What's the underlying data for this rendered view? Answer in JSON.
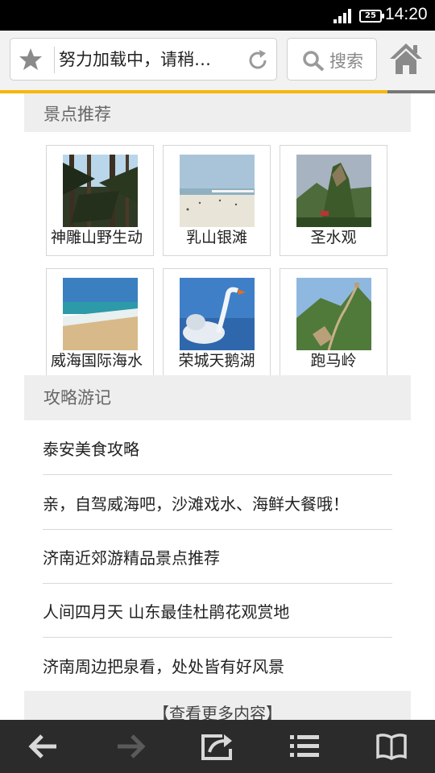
{
  "status_bar": {
    "battery": "25",
    "time": "14:20"
  },
  "browser": {
    "page_title": "努力加载中，请稍…",
    "search_label": "搜索",
    "load_progress": 0.89,
    "accent_color": "#f7b500"
  },
  "sections": {
    "attractions_title": "景点推荐",
    "guides_title": "攻略游记"
  },
  "attractions": [
    {
      "name": "神雕山野生动",
      "image": "pine-forest-photo"
    },
    {
      "name": "乳山银滩",
      "image": "beach-photo"
    },
    {
      "name": "圣水观",
      "image": "mountain-temple-photo"
    },
    {
      "name": "威海国际海水",
      "image": "seaside-beach-photo"
    },
    {
      "name": "荣城天鹅湖",
      "image": "swan-photo"
    },
    {
      "name": "跑马岭",
      "image": "great-wall-photo"
    }
  ],
  "guides": [
    {
      "title": "泰安美食攻略"
    },
    {
      "title": "亲，自驾威海吧，沙滩戏水、海鲜大餐哦！"
    },
    {
      "title": "济南近郊游精品景点推荐"
    },
    {
      "title": "人间四月天 山东最佳杜鹃花观赏地"
    },
    {
      "title": "济南周边把泉看，处处皆有好风景"
    }
  ],
  "more_label": "【查看更多内容】",
  "bottom_nav": [
    "back-icon",
    "forward-icon",
    "share-icon",
    "menu-icon",
    "bookmarks-icon"
  ]
}
